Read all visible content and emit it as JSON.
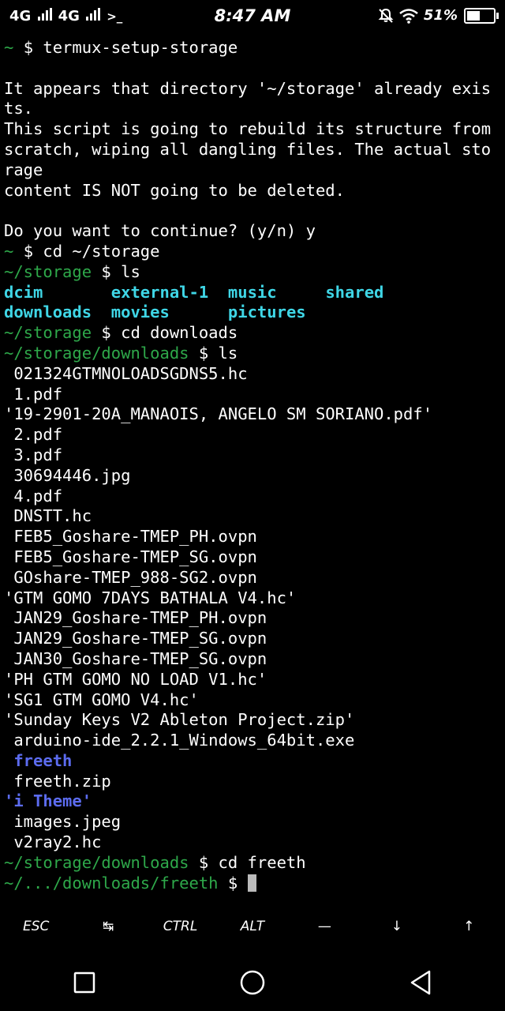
{
  "status_bar": {
    "network1": "4G",
    "network2": "4G",
    "prompt_icon": ">_",
    "time": "8:47 AM",
    "battery": "51%",
    "battery_level": 0.51
  },
  "terminal": {
    "lines": [
      {
        "parts": [
          {
            "t": "~ ",
            "c": "green"
          },
          {
            "t": "$ termux-setup-storage",
            "c": "white"
          }
        ]
      },
      {
        "parts": []
      },
      {
        "parts": [
          {
            "t": "It appears that directory '~/storage' already exis",
            "c": "white"
          }
        ]
      },
      {
        "parts": [
          {
            "t": "ts.",
            "c": "white"
          }
        ]
      },
      {
        "parts": [
          {
            "t": "This script is going to rebuild its structure from",
            "c": "white"
          }
        ]
      },
      {
        "parts": [
          {
            "t": "scratch, wiping all dangling files. The actual sto",
            "c": "white"
          }
        ]
      },
      {
        "parts": [
          {
            "t": "rage",
            "c": "white"
          }
        ]
      },
      {
        "parts": [
          {
            "t": "content IS NOT going to be deleted.",
            "c": "white"
          }
        ]
      },
      {
        "parts": []
      },
      {
        "parts": [
          {
            "t": "Do you want to continue? (y/n) y",
            "c": "white"
          }
        ]
      },
      {
        "parts": [
          {
            "t": "~ ",
            "c": "green"
          },
          {
            "t": "$ cd ~/storage",
            "c": "white"
          }
        ]
      },
      {
        "parts": [
          {
            "t": "~/storage ",
            "c": "green"
          },
          {
            "t": "$ ls",
            "c": "white"
          }
        ]
      },
      {
        "parts": [
          {
            "t": "dcim",
            "c": "cyan"
          },
          {
            "t": "       ",
            "c": "white"
          },
          {
            "t": "external-1",
            "c": "cyan"
          },
          {
            "t": "  ",
            "c": "white"
          },
          {
            "t": "music",
            "c": "cyan"
          },
          {
            "t": "     ",
            "c": "white"
          },
          {
            "t": "shared",
            "c": "cyan"
          }
        ]
      },
      {
        "parts": [
          {
            "t": "downloads",
            "c": "cyan"
          },
          {
            "t": "  ",
            "c": "white"
          },
          {
            "t": "movies",
            "c": "cyan"
          },
          {
            "t": "      ",
            "c": "white"
          },
          {
            "t": "pictures",
            "c": "cyan"
          }
        ]
      },
      {
        "parts": [
          {
            "t": "~/storage ",
            "c": "green"
          },
          {
            "t": "$ cd downloads",
            "c": "white"
          }
        ]
      },
      {
        "parts": [
          {
            "t": "~/storage/downloads ",
            "c": "green"
          },
          {
            "t": "$ ls",
            "c": "white"
          }
        ]
      },
      {
        "parts": [
          {
            "t": " 021324GTMNOLOADSGDNS5.hc",
            "c": "white"
          }
        ]
      },
      {
        "parts": [
          {
            "t": " 1.pdf",
            "c": "white"
          }
        ]
      },
      {
        "parts": [
          {
            "t": "'19-2901-20A_MANAOIS, ANGELO SM SORIANO.pdf'",
            "c": "white"
          }
        ]
      },
      {
        "parts": [
          {
            "t": " 2.pdf",
            "c": "white"
          }
        ]
      },
      {
        "parts": [
          {
            "t": " 3.pdf",
            "c": "white"
          }
        ]
      },
      {
        "parts": [
          {
            "t": " 30694446.jpg",
            "c": "white"
          }
        ]
      },
      {
        "parts": [
          {
            "t": " 4.pdf",
            "c": "white"
          }
        ]
      },
      {
        "parts": [
          {
            "t": " DNSTT.hc",
            "c": "white"
          }
        ]
      },
      {
        "parts": [
          {
            "t": " FEB5_Goshare-TMEP_PH.ovpn",
            "c": "white"
          }
        ]
      },
      {
        "parts": [
          {
            "t": " FEB5_Goshare-TMEP_SG.ovpn",
            "c": "white"
          }
        ]
      },
      {
        "parts": [
          {
            "t": " GOshare-TMEP_988-SG2.ovpn",
            "c": "white"
          }
        ]
      },
      {
        "parts": [
          {
            "t": "'GTM GOMO 7DAYS BATHALA V4.hc'",
            "c": "white"
          }
        ]
      },
      {
        "parts": [
          {
            "t": " JAN29_Goshare-TMEP_PH.ovpn",
            "c": "white"
          }
        ]
      },
      {
        "parts": [
          {
            "t": " JAN29_Goshare-TMEP_SG.ovpn",
            "c": "white"
          }
        ]
      },
      {
        "parts": [
          {
            "t": " JAN30_Goshare-TMEP_SG.ovpn",
            "c": "white"
          }
        ]
      },
      {
        "parts": [
          {
            "t": "'PH GTM GOMO NO LOAD V1.hc'",
            "c": "white"
          }
        ]
      },
      {
        "parts": [
          {
            "t": "'SG1 GTM GOMO V4.hc'",
            "c": "white"
          }
        ]
      },
      {
        "parts": [
          {
            "t": "'Sunday Keys V2 Ableton Project.zip'",
            "c": "white"
          }
        ]
      },
      {
        "parts": [
          {
            "t": " arduino-ide_2.2.1_Windows_64bit.exe",
            "c": "white"
          }
        ]
      },
      {
        "parts": [
          {
            "t": " ",
            "c": "white"
          },
          {
            "t": "freeth",
            "c": "blue"
          }
        ]
      },
      {
        "parts": [
          {
            "t": " freeth.zip",
            "c": "white"
          }
        ]
      },
      {
        "parts": [
          {
            "t": "'i Theme'",
            "c": "blue"
          }
        ]
      },
      {
        "parts": [
          {
            "t": " images.jpeg",
            "c": "white"
          }
        ]
      },
      {
        "parts": [
          {
            "t": " v2ray2.hc",
            "c": "white"
          }
        ]
      },
      {
        "parts": [
          {
            "t": "~/storage/downloads ",
            "c": "green"
          },
          {
            "t": "$ cd freeth",
            "c": "white"
          }
        ]
      },
      {
        "parts": [
          {
            "t": "~/.../downloads/freeth ",
            "c": "green"
          },
          {
            "t": "$ ",
            "c": "white"
          }
        ],
        "cursor": true
      }
    ]
  },
  "extra_keys": [
    "ESC",
    "↹",
    "CTRL",
    "ALT",
    "—",
    "↓",
    "↑"
  ],
  "nav": {
    "recents": "recents-icon",
    "home": "home-icon",
    "back": "back-icon"
  }
}
